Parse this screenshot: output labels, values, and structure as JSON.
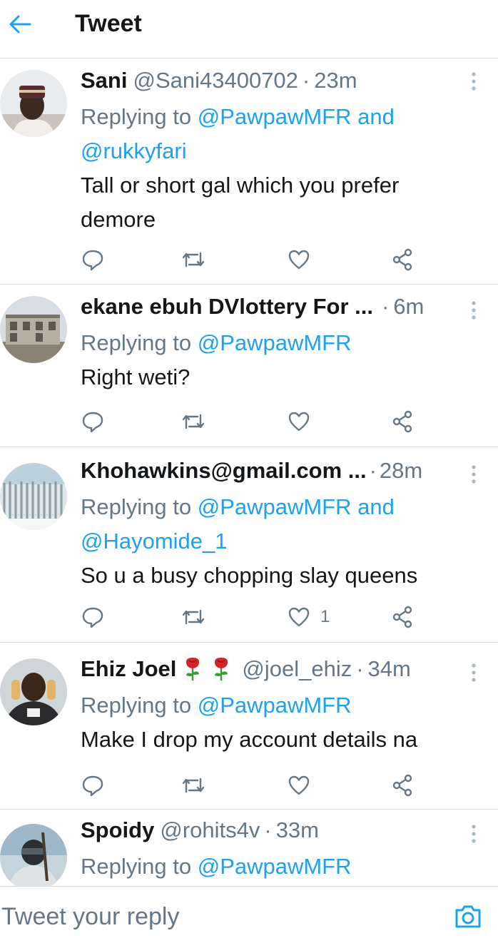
{
  "header": {
    "title": "Tweet",
    "back_icon": "arrow-left-icon"
  },
  "colors": {
    "accent": "#1da1f2",
    "muted": "#657786",
    "text": "#14171a",
    "divider": "#d8dde1"
  },
  "tweets": [
    {
      "name": "Sani",
      "handle": "@Sani43400702",
      "time": "23m",
      "replying_prefix": "Replying to",
      "mentions_line1": "@PawpawMFR and",
      "mentions_line2": "@rukkyfari",
      "text_line1": "Tall or short gal which you prefer",
      "text_line2": "demore"
    },
    {
      "name": "ekane ebuh DVlottery For ...",
      "time": "6m",
      "replying_prefix": "Replying to",
      "mentions_line1": "@PawpawMFR",
      "text_line1": "Right weti?"
    },
    {
      "name": "Khohawkins@gmail.com ...",
      "time": "28m",
      "replying_prefix": "Replying to",
      "mentions_line1": "@PawpawMFR and",
      "mentions_line2": "@Hayomide_1",
      "text_line1": "So u a busy chopping slay queens",
      "like_count": "1"
    },
    {
      "name": "Ehiz Joel",
      "handle": "@joel_ehiz",
      "time": "34m",
      "replying_prefix": "Replying to",
      "mentions_line1": "@PawpawMFR",
      "text_line1": "Make I drop my account details na"
    },
    {
      "name": "Spoidy",
      "handle": "@rohits4v",
      "time": "33m",
      "replying_prefix": "Replying to",
      "mentions_line1": "@PawpawMFR"
    }
  ],
  "composer": {
    "placeholder": "Tweet your reply",
    "camera_icon": "camera-icon"
  },
  "separator": "·"
}
